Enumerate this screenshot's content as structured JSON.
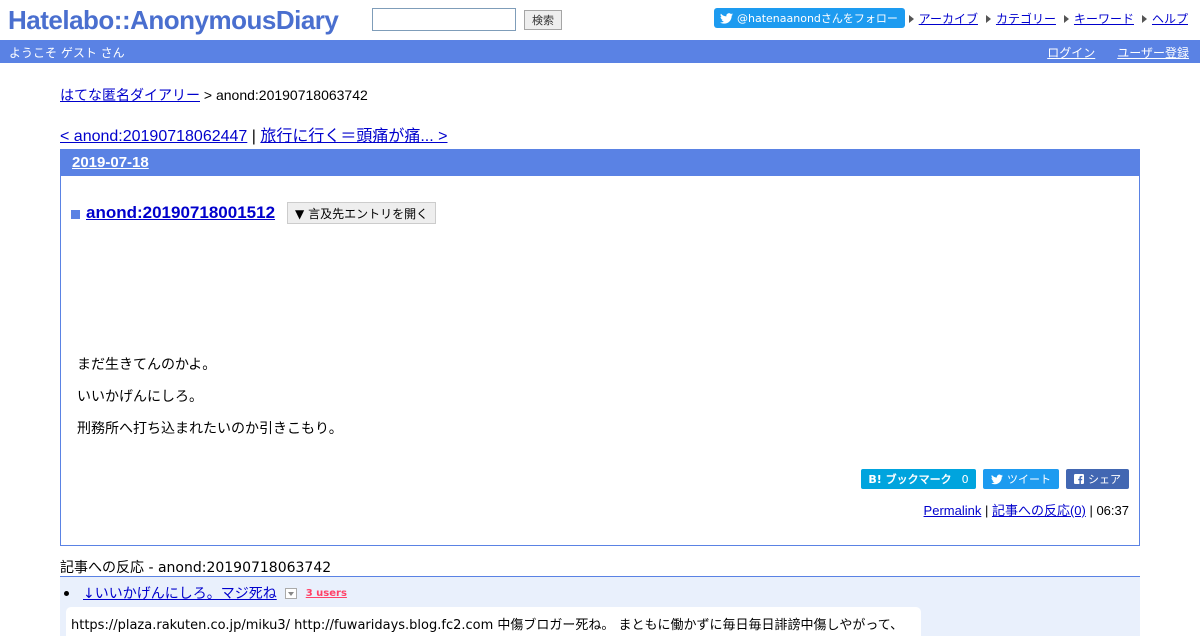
{
  "header": {
    "logo": "Hatelabo::AnonymousDiary",
    "search_placeholder": "",
    "search_button": "検索",
    "follow_button": "@hatenaanondさんをフォロー",
    "nav": [
      "アーカイブ",
      "カテゴリー",
      "キーワード",
      "ヘルプ"
    ]
  },
  "userbar": {
    "welcome": "ようこそ ゲスト さん",
    "login": "ログイン",
    "register": "ユーザー登録"
  },
  "breadcrumb": {
    "home": "はてな匿名ダイアリー",
    "separator": " > ",
    "current": "anond:20190718063742"
  },
  "pagenav": {
    "prev": "< anond:20190718062447",
    "separator": " | ",
    "next": "旅行に行く＝頭痛が痛... >"
  },
  "entry": {
    "date": "2019-07-18",
    "title": "anond:20190718001512",
    "mention_button": "▼ 言及先エントリを開く",
    "body": [
      "まだ生きてんのかよ。",
      "いいかげんにしろ。",
      "刑務所へ打ち込まれたいのか引きこもり。"
    ],
    "share": {
      "bookmark_label": "B! ブックマーク",
      "bookmark_count": "0",
      "tweet_label": "ツイート",
      "share_label": "シェア"
    },
    "footer": {
      "permalink": "Permalink",
      "sep1": " | ",
      "reactions": "記事への反応(0)",
      "sep2": " | ",
      "time": "06:37"
    }
  },
  "reactions": {
    "title": "記事への反応 - anond:20190718063742",
    "items": [
      {
        "title": "↓いいかげんにしろ。マジ死ね",
        "users": "3 users",
        "snippet": "https://plaza.rakuten.co.jp/miku3/ http://fuwaridays.blog.fc2.com 中傷ブロガー死ね。 まともに働かずに毎日毎日誹謗中傷しやがって、"
      }
    ]
  },
  "colors": {
    "accent": "#5a82e4",
    "link": "#0000cc",
    "twitter": "#1d9bf0",
    "hatena_bookmark": "#00a4de",
    "facebook": "#4267b2",
    "users_badge": "#ff4166",
    "reactions_bg": "#e9f0fc"
  }
}
